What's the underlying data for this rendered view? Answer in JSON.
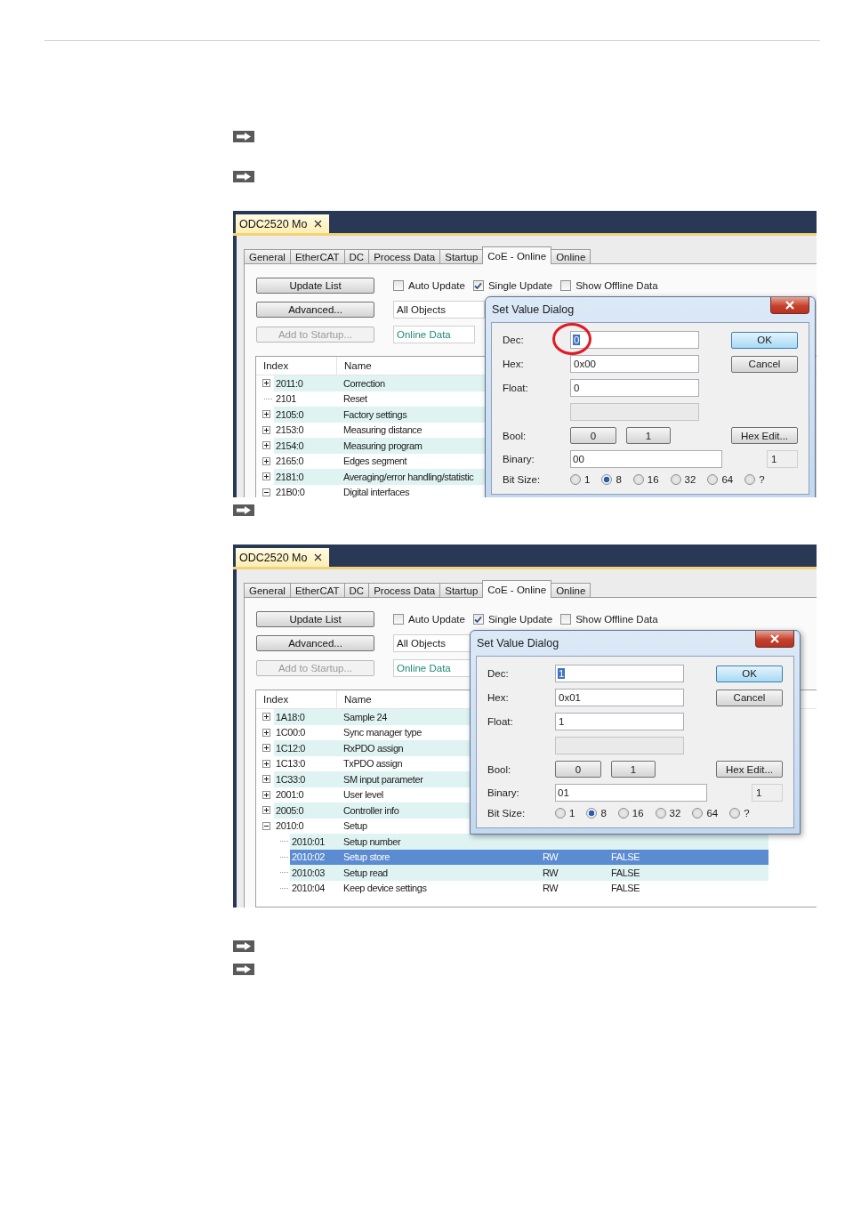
{
  "screenshots": [
    {
      "document_tab": {
        "title": "ODC2520 Mo"
      },
      "tabs": [
        {
          "label": "General",
          "selected": false
        },
        {
          "label": "EtherCAT",
          "selected": false
        },
        {
          "label": "DC",
          "selected": false
        },
        {
          "label": "Process Data",
          "selected": false
        },
        {
          "label": "Startup",
          "selected": false
        },
        {
          "label": "CoE - Online",
          "selected": true
        },
        {
          "label": "Online",
          "selected": false
        }
      ],
      "buttons": [
        {
          "label": "Update List",
          "disabled": false
        },
        {
          "label": "Advanced...",
          "disabled": false
        },
        {
          "label": "Add to Startup...",
          "disabled": true
        }
      ],
      "options": [
        {
          "label": "Auto Update",
          "checked": false
        },
        {
          "label": "Single Update",
          "checked": true
        },
        {
          "label": "Show Offline Data",
          "checked": false
        }
      ],
      "object_filter": "All Objects",
      "data_source": "Online Data",
      "table": {
        "columns": [
          "Index",
          "Name"
        ],
        "rows": [
          {
            "index": "2011:0",
            "name": "Correction",
            "expanded": false,
            "selected": false
          },
          {
            "index": "2101",
            "name": "Reset",
            "selected": false
          },
          {
            "index": "2105:0",
            "name": "Factory settings",
            "expanded": false,
            "selected": false
          },
          {
            "index": "2153:0",
            "name": "Measuring distance",
            "expanded": false,
            "selected": false
          },
          {
            "index": "2154:0",
            "name": "Measuring program",
            "expanded": false,
            "selected": false
          },
          {
            "index": "2165:0",
            "name": "Edges segment",
            "expanded": false,
            "selected": false
          },
          {
            "index": "2181:0",
            "name": "Averaging/error handling/statistic",
            "expanded": false,
            "selected": false
          },
          {
            "index": "21B0:0",
            "name": "Digital interfaces",
            "expanded": true,
            "selected": false
          }
        ]
      },
      "dialog": {
        "title": "Set Value Dialog",
        "rows": [
          {
            "kind": "field",
            "label": "Dec:",
            "value": "0",
            "value_selected": true,
            "circled": true,
            "button": {
              "label": "OK",
              "default": true
            }
          },
          {
            "kind": "field",
            "label": "Hex:",
            "value": "0x00",
            "button": {
              "label": "Cancel",
              "default": false
            }
          },
          {
            "kind": "field",
            "label": "Float:",
            "value": "0"
          },
          {
            "kind": "blank"
          },
          {
            "kind": "bool",
            "label": "Bool:",
            "options": [
              "0",
              "1"
            ],
            "button": {
              "label": "Hex Edit...",
              "default": false
            }
          },
          {
            "kind": "binary",
            "label": "Binary:",
            "value": "00",
            "count": "1"
          },
          {
            "kind": "radio",
            "label": "Bit Size:",
            "options": [
              {
                "label": "1",
                "selected": false
              },
              {
                "label": "8",
                "selected": true
              },
              {
                "label": "16",
                "selected": false
              },
              {
                "label": "32",
                "selected": false
              },
              {
                "label": "64",
                "selected": false
              },
              {
                "label": "?",
                "selected": false
              }
            ]
          }
        ]
      }
    },
    {
      "document_tab": {
        "title": "ODC2520 Mo"
      },
      "tabs": [
        {
          "label": "General",
          "selected": false
        },
        {
          "label": "EtherCAT",
          "selected": false
        },
        {
          "label": "DC",
          "selected": false
        },
        {
          "label": "Process Data",
          "selected": false
        },
        {
          "label": "Startup",
          "selected": false
        },
        {
          "label": "CoE - Online",
          "selected": true
        },
        {
          "label": "Online",
          "selected": false
        }
      ],
      "buttons": [
        {
          "label": "Update List",
          "disabled": false
        },
        {
          "label": "Advanced...",
          "disabled": false
        },
        {
          "label": "Add to Startup...",
          "disabled": true
        }
      ],
      "options": [
        {
          "label": "Auto Update",
          "checked": false
        },
        {
          "label": "Single Update",
          "checked": true
        },
        {
          "label": "Show Offline Data",
          "checked": false
        }
      ],
      "object_filter": "All Objects",
      "data_source": "Online Data",
      "table": {
        "columns": [
          "Index",
          "Name"
        ],
        "rows": [
          {
            "index": "1A18:0",
            "name": "Sample 24",
            "expanded": false,
            "selected": false
          },
          {
            "index": "1C00:0",
            "name": "Sync manager type",
            "expanded": false,
            "selected": false
          },
          {
            "index": "1C12:0",
            "name": "RxPDO assign",
            "expanded": false,
            "selected": false
          },
          {
            "index": "1C13:0",
            "name": "TxPDO assign",
            "expanded": false,
            "selected": false
          },
          {
            "index": "1C33:0",
            "name": "SM input parameter",
            "expanded": false,
            "selected": false
          },
          {
            "index": "2001:0",
            "name": "User level",
            "expanded": false,
            "selected": false
          },
          {
            "index": "2005:0",
            "name": "Controller info",
            "expanded": false,
            "selected": false
          },
          {
            "index": "2010:0",
            "name": "Setup",
            "expanded": true,
            "selected": false,
            "children": [
              {
                "index": "2010:01",
                "name": "Setup number",
                "selected": false
              },
              {
                "index": "2010:02",
                "name": "Setup store",
                "flags": "RW",
                "value": "FALSE",
                "selected": true
              },
              {
                "index": "2010:03",
                "name": "Setup read",
                "flags": "RW",
                "value": "FALSE",
                "selected": false
              },
              {
                "index": "2010:04",
                "name": "Keep device settings",
                "flags": "RW",
                "value": "FALSE",
                "selected": false
              }
            ]
          }
        ]
      },
      "dialog": {
        "title": "Set Value Dialog",
        "rows": [
          {
            "kind": "field",
            "label": "Dec:",
            "value": "1",
            "value_selected": true,
            "button": {
              "label": "OK",
              "default": true
            }
          },
          {
            "kind": "field",
            "label": "Hex:",
            "value": "0x01",
            "button": {
              "label": "Cancel",
              "default": false
            }
          },
          {
            "kind": "field",
            "label": "Float:",
            "value": "1"
          },
          {
            "kind": "blank"
          },
          {
            "kind": "bool",
            "label": "Bool:",
            "options": [
              "0",
              "1"
            ],
            "button": {
              "label": "Hex Edit...",
              "default": false
            }
          },
          {
            "kind": "binary",
            "label": "Binary:",
            "value": "01",
            "count": "1"
          },
          {
            "kind": "radio",
            "label": "Bit Size:",
            "options": [
              {
                "label": "1",
                "selected": false
              },
              {
                "label": "8",
                "selected": true
              },
              {
                "label": "16",
                "selected": false
              },
              {
                "label": "32",
                "selected": false
              },
              {
                "label": "64",
                "selected": false
              },
              {
                "label": "?",
                "selected": false
              }
            ]
          }
        ]
      }
    }
  ]
}
